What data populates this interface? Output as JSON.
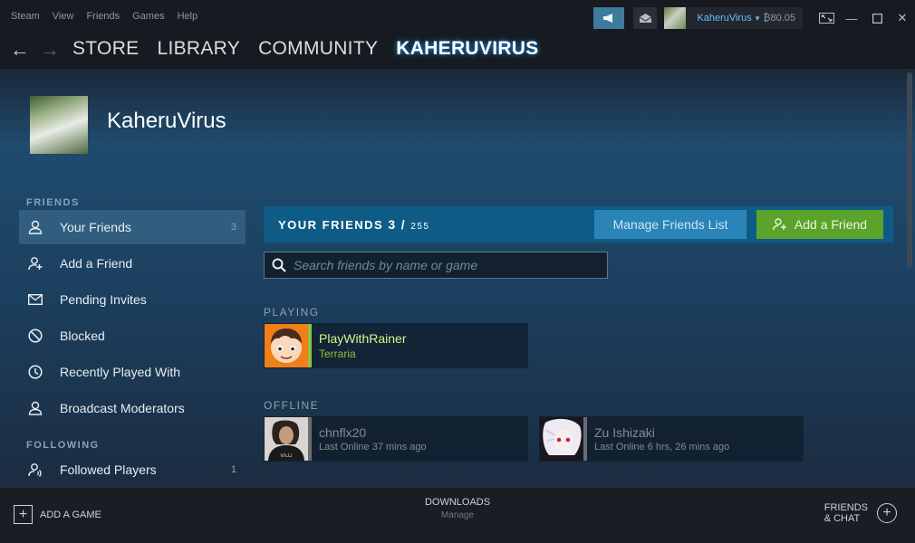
{
  "menu": [
    "Steam",
    "View",
    "Friends",
    "Games",
    "Help"
  ],
  "account": {
    "name": "KaheruVirus",
    "balance": "₿80.05"
  },
  "nav": {
    "back": "←",
    "forward": "→",
    "links": [
      "STORE",
      "LIBRARY",
      "COMMUNITY",
      "KAHERUVIRUS"
    ]
  },
  "profile": {
    "name": "KaheruVirus"
  },
  "sidebar": {
    "friends_header": "FRIENDS",
    "items": [
      {
        "label": "Your Friends",
        "count": "3",
        "icon": "person-icon"
      },
      {
        "label": "Add a Friend",
        "icon": "add-person-icon"
      },
      {
        "label": "Pending Invites",
        "icon": "envelope-icon"
      },
      {
        "label": "Blocked",
        "icon": "blocked-icon"
      },
      {
        "label": "Recently Played With",
        "icon": "clock-icon"
      },
      {
        "label": "Broadcast Moderators",
        "icon": "person-icon"
      }
    ],
    "following_header": "FOLLOWING",
    "following_items": [
      {
        "label": "Followed Players",
        "count": "1",
        "icon": "followed-icon"
      }
    ]
  },
  "friends_bar": {
    "title": "YOUR FRIENDS",
    "count": "3",
    "slash": "/",
    "max": "255",
    "manage_label": "Manage Friends List",
    "add_label": "Add a Friend"
  },
  "search": {
    "placeholder": "Search friends by name or game"
  },
  "playing": {
    "header": "PLAYING",
    "friends": [
      {
        "name": "PlayWithRainer",
        "status": "Terraria"
      }
    ]
  },
  "offline": {
    "header": "OFFLINE",
    "friends": [
      {
        "name": "chnflx20",
        "status": "Last Online 37 mins ago"
      },
      {
        "name": "Zu Ishizaki",
        "status": "Last Online 6 hrs, 26 mins ago"
      }
    ]
  },
  "bottom": {
    "add_game": "ADD A GAME",
    "downloads": "DOWNLOADS",
    "manage": "Manage",
    "friends_chat_1": "FRIENDS",
    "friends_chat_2": "& CHAT"
  },
  "colors": {
    "ingame": "#a3cf06",
    "ingame_bar": "#8bc53f",
    "offline": "#898989",
    "accent": "#1a9fff"
  }
}
